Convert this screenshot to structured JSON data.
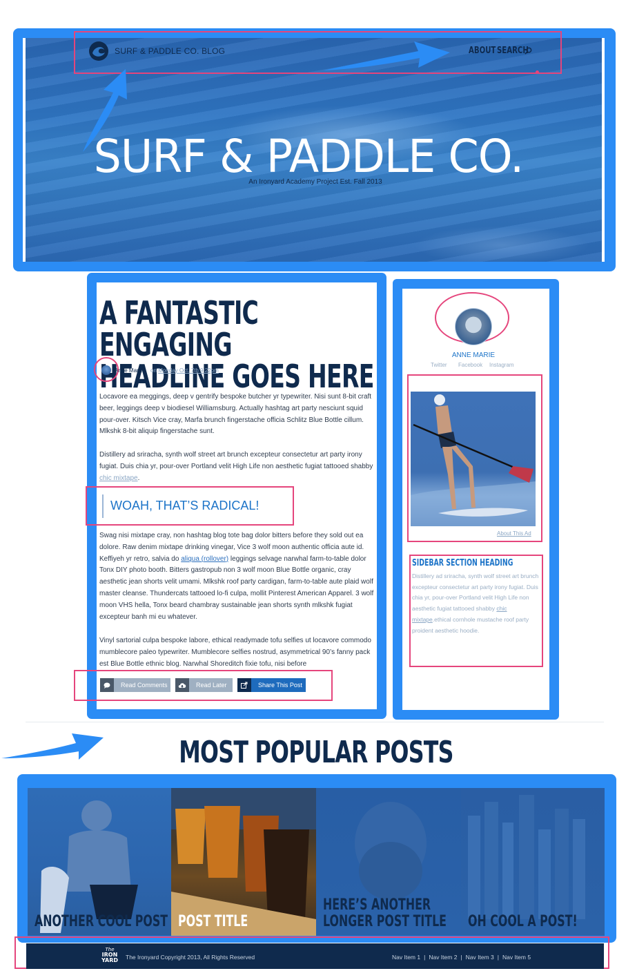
{
  "header": {
    "blog_name": "SURF & PADDLE CO. BLOG",
    "nav": {
      "about": "ABOUT",
      "search": "SEARCH"
    },
    "hero_title": "SURF & PADDLE CO.",
    "hero_subtitle": "An Ironyard Academy Project Est. Fall 2013"
  },
  "post": {
    "headline_line1": "A FANTASTIC ENGAGING",
    "headline_line2": "HEADLINE GOES HERE",
    "author": "Anne Marie",
    "date_prefix": "on",
    "date": "Monday Oct. 7th 9:22pm",
    "paragraph1": "Locavore ea meggings, deep v gentrify bespoke butcher yr typewriter. Nisi sunt 8-bit craft beer, leggings deep v biodiesel Williamsburg. Actually hashtag art party nesciunt squid pour-over. Kitsch Vice cray, Marfa brunch fingerstache officia Schlitz Blue Bottle cillum. Mlkshk 8-bit aliquip fingerstache sunt.",
    "paragraph2_text": "Distillery ad sriracha, synth wolf street art brunch excepteur consectetur art party irony fugiat. Duis chia yr, pour-over Portland velit High Life non aesthetic fugiat tattooed shabby",
    "paragraph2_link": "chic mixtape",
    "paragraph2_end": ".",
    "quote": "WOAH, THAT’S RADICAL!",
    "paragraph3_start": "Swag nisi mixtape cray, non hashtag blog tote bag dolor bitters before they sold out ea dolore. Raw denim mixtape drinking vinegar, Vice 3 wolf moon authentic officia aute id. Keffiyeh yr retro, salvia do",
    "paragraph3_link": "aliqua (rollover)",
    "paragraph3_end": "leggings selvage narwhal farm-to-table dolor Tonx DIY photo booth. Bitters gastropub non 3 wolf moon Blue Bottle organic, cray aesthetic jean shorts velit umami. Mlkshk roof party cardigan, farm-to-table aute plaid wolf master cleanse. Thundercats tattooed lo-fi culpa, mollit Pinterest American Apparel. 3 wolf moon VHS hella, Tonx beard chambray sustainable jean shorts synth mlkshk fugiat excepteur banh mi eu whatever.",
    "paragraph4": "Vinyl sartorial culpa bespoke labore, ethical readymade tofu selfies ut locavore commodo mumblecore paleo typewriter. Mumblecore selfies nostrud, asymmetrical 90’s fanny pack est Blue Bottle ethnic blog. Narwhal Shoreditch fixie tofu, nisi before",
    "actions": {
      "read_comments": "Read Comments",
      "read_later": "Read Later",
      "share": "Share This Post"
    }
  },
  "sidebar": {
    "profile_name": "ANNE MARIE",
    "social": [
      "Twitter",
      "Facebook",
      "Instagram"
    ],
    "ad_link": "About This Ad",
    "section_heading": "SIDEBAR SECTION HEADING",
    "section_text_start": "Distillery ad sriracha, synth wolf street art brunch excepteur consectetur art party irony fugiat. Duis chia yr, pour-over Portland velit High Life non aesthetic fugiat tattooed shabby",
    "section_link": "chic mixtape",
    "section_text_end": ".ethical cornhole mustache roof party proident aesthetic hoodie."
  },
  "popular": {
    "title": "MOST POPULAR POSTS",
    "tiles": [
      {
        "label_line1": "ANOTHER COOL POST",
        "label_line2": ""
      },
      {
        "label_line1": "POST TITLE",
        "label_line2": ""
      },
      {
        "label_line1": "HERE’S ANOTHER",
        "label_line2": "LONGER POST TITLE"
      },
      {
        "label_line1": "OH COOL A POST!",
        "label_line2": ""
      }
    ]
  },
  "footer": {
    "logo_line1": "The",
    "logo_line2": "IRON",
    "logo_line3": "YARD",
    "copyright": "The Ironyard Copyright 2013, All Rights Reserved",
    "nav": [
      "Nav Item 1",
      "Nav Item 2",
      "Nav Item 3",
      "Nav Item 5"
    ]
  },
  "colors": {
    "annotation_blue": "#2b8cf5",
    "annotation_pink": "#e5457c",
    "navy": "#0f2a4d",
    "accent_blue": "#1d74c8"
  }
}
